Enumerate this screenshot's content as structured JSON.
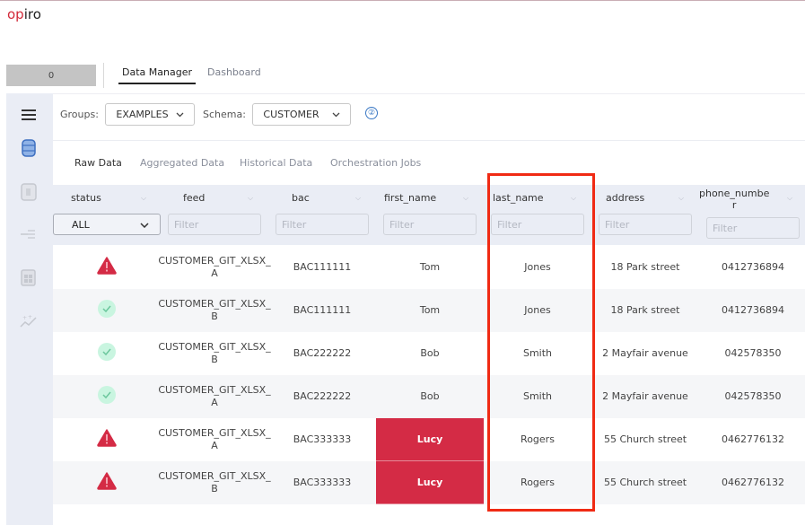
{
  "logo": {
    "brand_red": "op",
    "brand_dark": "iro",
    "accent_color": "#d22b3a"
  },
  "header": {
    "counter_value": "0",
    "nav_tabs": [
      {
        "label": "Data Manager",
        "active": true
      },
      {
        "label": "Dashboard",
        "active": false
      }
    ]
  },
  "sidebar": {
    "items": [
      {
        "icon": "menu-icon"
      },
      {
        "icon": "database-icon",
        "active": true
      },
      {
        "icon": "document-icon"
      },
      {
        "icon": "plug-icon"
      },
      {
        "icon": "calendar-icon"
      },
      {
        "icon": "sparkle-chart-icon"
      }
    ]
  },
  "toolbar": {
    "groups_label": "Groups:",
    "groups_value": "EXAMPLES",
    "schema_label": "Schema:",
    "schema_value": "CUSTOMER",
    "help_glyph": "②"
  },
  "subtabs": [
    {
      "label": "Raw Data",
      "active": true
    },
    {
      "label": "Aggregated Data",
      "active": false
    },
    {
      "label": "Historical Data",
      "active": false
    },
    {
      "label": "Orchestration Jobs",
      "active": false
    }
  ],
  "table": {
    "columns": [
      {
        "key": "status",
        "label": "status"
      },
      {
        "key": "feed",
        "label": "feed"
      },
      {
        "key": "bac",
        "label": "bac"
      },
      {
        "key": "first_name",
        "label": "first_name"
      },
      {
        "key": "last_name",
        "label": "last_name"
      },
      {
        "key": "address",
        "label": "address"
      },
      {
        "key": "phone_number",
        "label": "phone_numbe\nr"
      }
    ],
    "status_filter_value": "ALL",
    "filter_placeholder": "Filter",
    "highlighted_column": "last_name",
    "error_color": "#d42b45",
    "ok_color": "#c9f5e0",
    "rows": [
      {
        "status": "error",
        "feed": "CUSTOMER_GIT_XLSX_\nA",
        "bac": "BAC111111",
        "first_name": "Tom",
        "first_name_error": false,
        "last_name": "Jones",
        "address": "18 Park street",
        "phone_number": "0412736894"
      },
      {
        "status": "ok",
        "feed": "CUSTOMER_GIT_XLSX_\nB",
        "bac": "BAC111111",
        "first_name": "Tom",
        "first_name_error": false,
        "last_name": "Jones",
        "address": "18 Park street",
        "phone_number": "0412736894"
      },
      {
        "status": "ok",
        "feed": "CUSTOMER_GIT_XLSX_\nB",
        "bac": "BAC222222",
        "first_name": "Bob",
        "first_name_error": false,
        "last_name": "Smith",
        "address": "2 Mayfair avenue",
        "phone_number": "042578350"
      },
      {
        "status": "ok",
        "feed": "CUSTOMER_GIT_XLSX_\nA",
        "bac": "BAC222222",
        "first_name": "Bob",
        "first_name_error": false,
        "last_name": "Smith",
        "address": "2 Mayfair avenue",
        "phone_number": "042578350"
      },
      {
        "status": "error",
        "feed": "CUSTOMER_GIT_XLSX_\nA",
        "bac": "BAC333333",
        "first_name": "Lucy",
        "first_name_error": true,
        "last_name": "Rogers",
        "address": "55 Church street",
        "phone_number": "0462776132"
      },
      {
        "status": "error",
        "feed": "CUSTOMER_GIT_XLSX_\nB",
        "bac": "BAC333333",
        "first_name": "Lucy",
        "first_name_error": true,
        "last_name": "Rogers",
        "address": "55 Church street",
        "phone_number": "0462776132"
      }
    ]
  }
}
